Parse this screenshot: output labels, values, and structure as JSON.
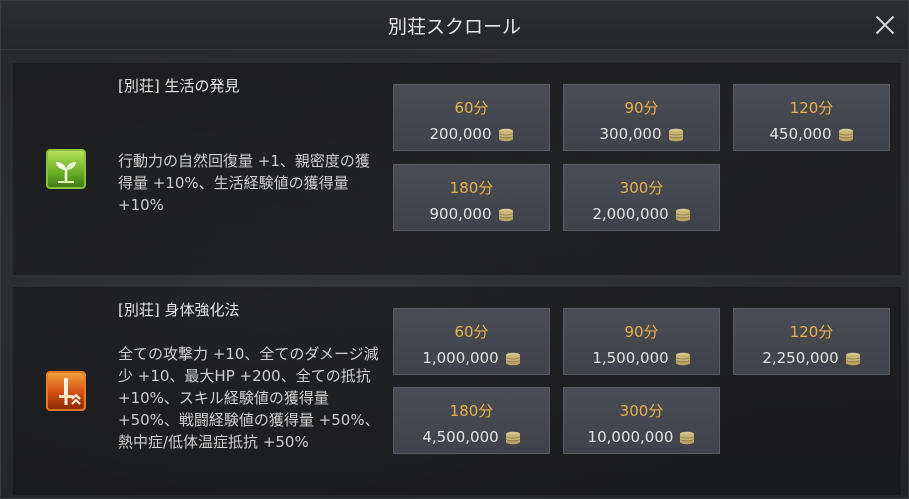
{
  "window": {
    "title": "別荘スクロール"
  },
  "sections": [
    {
      "heading": "[別荘] 生活の発見",
      "icon": "sprout-icon",
      "description": "行動力の自然回復量 +1、親密度の獲得量 +10%、生活経験値の獲得量 +10%",
      "options": [
        {
          "duration": "60分",
          "price": "200,000"
        },
        {
          "duration": "90分",
          "price": "300,000"
        },
        {
          "duration": "120分",
          "price": "450,000"
        },
        {
          "duration": "180分",
          "price": "900,000"
        },
        {
          "duration": "300分",
          "price": "2,000,000"
        }
      ]
    },
    {
      "heading": "[別荘] 身体強化法",
      "icon": "sword-icon",
      "description": "全ての攻撃力 +10、全てのダメージ減少 +10、最大HP +200、全ての抵抗 +10%、スキル経験値の獲得量 +50%、戦闘経験値の獲得量 +50%、熱中症/低体温症抵抗 +50%",
      "options": [
        {
          "duration": "60分",
          "price": "1,000,000"
        },
        {
          "duration": "90分",
          "price": "1,500,000"
        },
        {
          "duration": "120分",
          "price": "2,250,000"
        },
        {
          "duration": "180分",
          "price": "4,500,000"
        },
        {
          "duration": "300分",
          "price": "10,000,000"
        }
      ]
    }
  ],
  "colors": {
    "duration_text": "#e7b14a",
    "button_bg": "#464850",
    "coin": "#c9b57a"
  }
}
